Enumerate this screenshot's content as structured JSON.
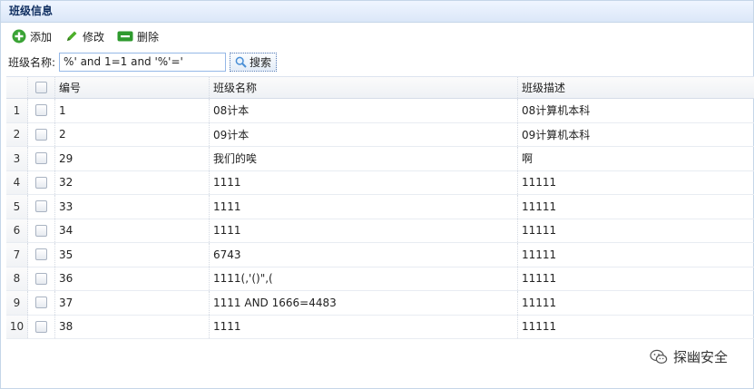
{
  "panel": {
    "title": "班级信息"
  },
  "toolbar": {
    "add_label": "添加",
    "edit_label": "修改",
    "delete_label": "删除"
  },
  "search": {
    "label": "班级名称:",
    "value": "%' and 1=1 and '%'='",
    "button_label": "搜索"
  },
  "grid": {
    "columns": {
      "id": "编号",
      "name": "班级名称",
      "desc": "班级描述"
    },
    "rows": [
      {
        "rn": "1",
        "id": "1",
        "name": "08计本",
        "desc": "08计算机本科"
      },
      {
        "rn": "2",
        "id": "2",
        "name": "09计本",
        "desc": "09计算机本科"
      },
      {
        "rn": "3",
        "id": "29",
        "name": "我们的唉",
        "desc": "啊"
      },
      {
        "rn": "4",
        "id": "32",
        "name": "1111",
        "desc": "11111"
      },
      {
        "rn": "5",
        "id": "33",
        "name": "1111",
        "desc": "11111"
      },
      {
        "rn": "6",
        "id": "34",
        "name": "1111",
        "desc": "11111"
      },
      {
        "rn": "7",
        "id": "35",
        "name": "6743",
        "desc": "11111"
      },
      {
        "rn": "8",
        "id": "36",
        "name": "1111(,'()\",(",
        "desc": "11111"
      },
      {
        "rn": "9",
        "id": "37",
        "name": "1111 AND 1666=4483",
        "desc": "11111"
      },
      {
        "rn": "10",
        "id": "38",
        "name": "1111",
        "desc": "11111"
      }
    ]
  },
  "watermark": {
    "text": "探幽安全"
  },
  "colors": {
    "add_icon": "#3aa335",
    "edit_icon": "#4caf2a",
    "delete_icon": "#2e9a2e",
    "search_icon": "#4a8fd6"
  }
}
